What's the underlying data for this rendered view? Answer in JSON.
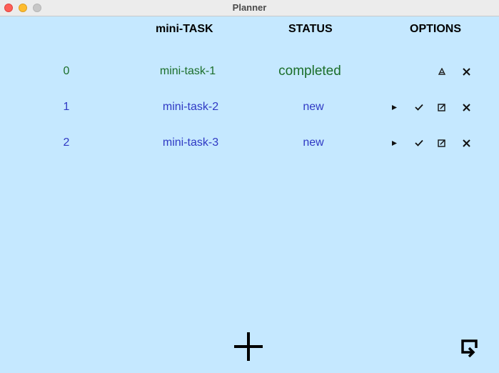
{
  "window": {
    "title": "Planner"
  },
  "columns": {
    "task": "mini-TASK",
    "status": "STATUS",
    "options": "OPTIONS"
  },
  "tasks": [
    {
      "index": "0",
      "name": "mini-task-1",
      "status": "completed"
    },
    {
      "index": "1",
      "name": "mini-task-2",
      "status": "new"
    },
    {
      "index": "2",
      "name": "mini-task-3",
      "status": "new"
    }
  ],
  "icons": {
    "row0": [
      "revert-icon",
      "delete-icon"
    ],
    "row1": [
      "start-icon",
      "complete-icon",
      "edit-icon",
      "delete-icon"
    ],
    "row2": [
      "start-icon",
      "complete-icon",
      "edit-icon",
      "delete-icon"
    ],
    "footer": [
      "add-icon",
      "exit-icon"
    ]
  },
  "colors": {
    "background": "#c5e8ff",
    "completed": "#1b6e2a",
    "new": "#2f39c4"
  }
}
